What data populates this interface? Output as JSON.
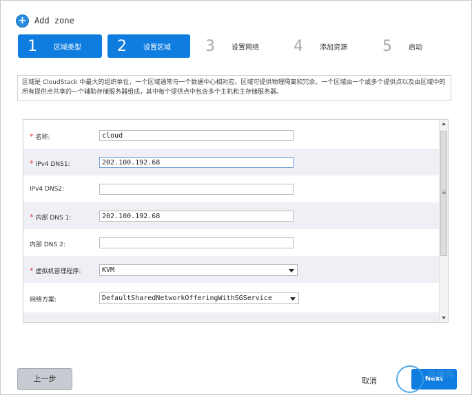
{
  "header": {
    "title": "Add zone"
  },
  "steps": [
    {
      "num": "1",
      "label": "区域类型",
      "active": true
    },
    {
      "num": "2",
      "label": "设置区域",
      "active": true
    },
    {
      "num": "3",
      "label": "设置网络",
      "active": false
    },
    {
      "num": "4",
      "label": "添加资源",
      "active": false
    },
    {
      "num": "5",
      "label": "启动",
      "active": false
    }
  ],
  "description": "区域是 CloudStack 中最大的组织单位，一个区域通常与一个数据中心相对应。区域可提供物理隔离和冗余。一个区域由一个或多个提供点以及由区域中的所有提供点共享的一个辅助存储服务器组成，其中每个提供点中包含多个主机和主存储服务器。",
  "form": {
    "rows": [
      {
        "label": "名称:",
        "required": true,
        "value": "cloud"
      },
      {
        "label": "IPv4 DNS1:",
        "required": true,
        "value": "202.100.192.68"
      },
      {
        "label": "IPv4 DNS2:",
        "required": false,
        "value": ""
      },
      {
        "label": "内部 DNS 1:",
        "required": true,
        "value": "202.100.192.68"
      },
      {
        "label": "内部 DNS 2:",
        "required": false,
        "value": ""
      },
      {
        "label": "虚拟机管理程序:",
        "required": true,
        "value": "KVM"
      },
      {
        "label": "网络方案:",
        "required": false,
        "value": "DefaultSharedNetworkOfferingWithSGService"
      }
    ],
    "required_marker": "*"
  },
  "footer": {
    "prev_label": "上一步",
    "cancel_label": "取消",
    "next_label": "Next",
    "watermark_text": "运维网"
  },
  "colors": {
    "accent": "#0f7ce0",
    "required": "#e23b3b",
    "alt_row": "#eef0f6"
  }
}
